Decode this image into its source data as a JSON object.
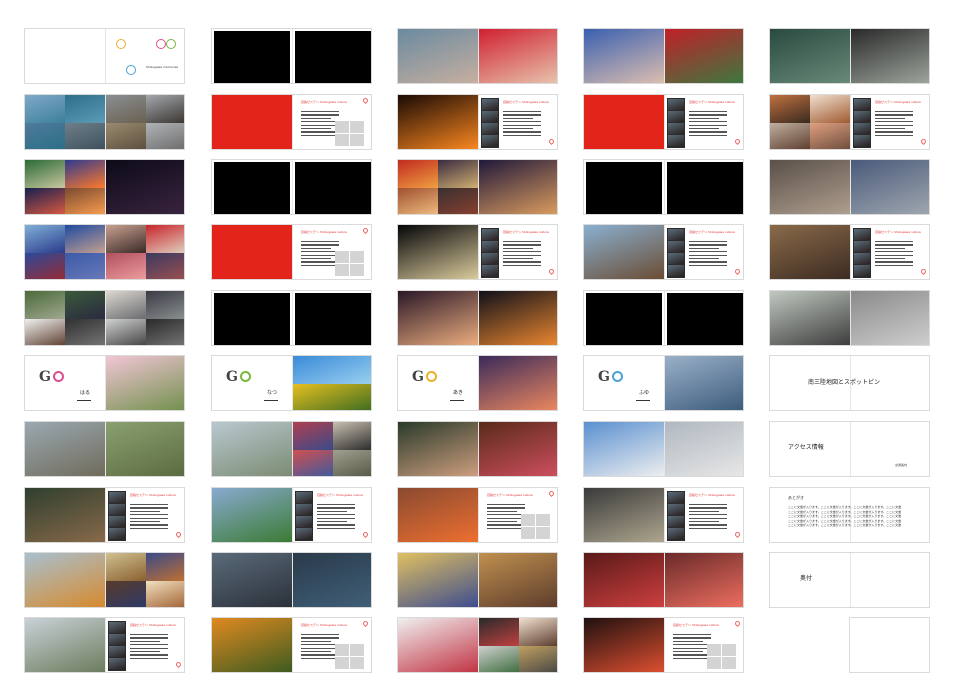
{
  "title": {
    "cover_caption": "Shizugawa memories"
  },
  "seasons": {
    "spring": "はる",
    "summer": "なつ",
    "autumn": "あき",
    "winter": "ふゆ",
    "logo_letter": "G"
  },
  "features": {
    "heading": "目指せステ〜 Shizugawa nature"
  },
  "endmatter": {
    "map_title": "南三陸地図とスポットピン",
    "access_title": "アクセス情報",
    "access_sub": "交通案内",
    "afterword_title": "あとがき",
    "colophon_title": "奥付",
    "afterword_lines": [
      "ここに文章が入ります。ここに文章が入ります。ここに文章が入ります。ここに文章",
      "ここに文章が入ります。ここに文章が入ります。ここに文章が入ります。ここに文章",
      "ここに文章が入ります。ここに文章が入ります。ここに文章が入ります。ここに文章",
      "ここに文章が入ります。ここに文章が入ります。ここに文章が入ります。ここに文章",
      "ここに文章が入ります。ここに文章が入ります。ここに文章が入ります。ここに文章"
    ]
  },
  "colors": {
    "red": "#e3241b",
    "spring": "#e04c8f",
    "summer": "#78b83c",
    "autumn": "#e8b12a",
    "winter": "#4aa3d8"
  }
}
